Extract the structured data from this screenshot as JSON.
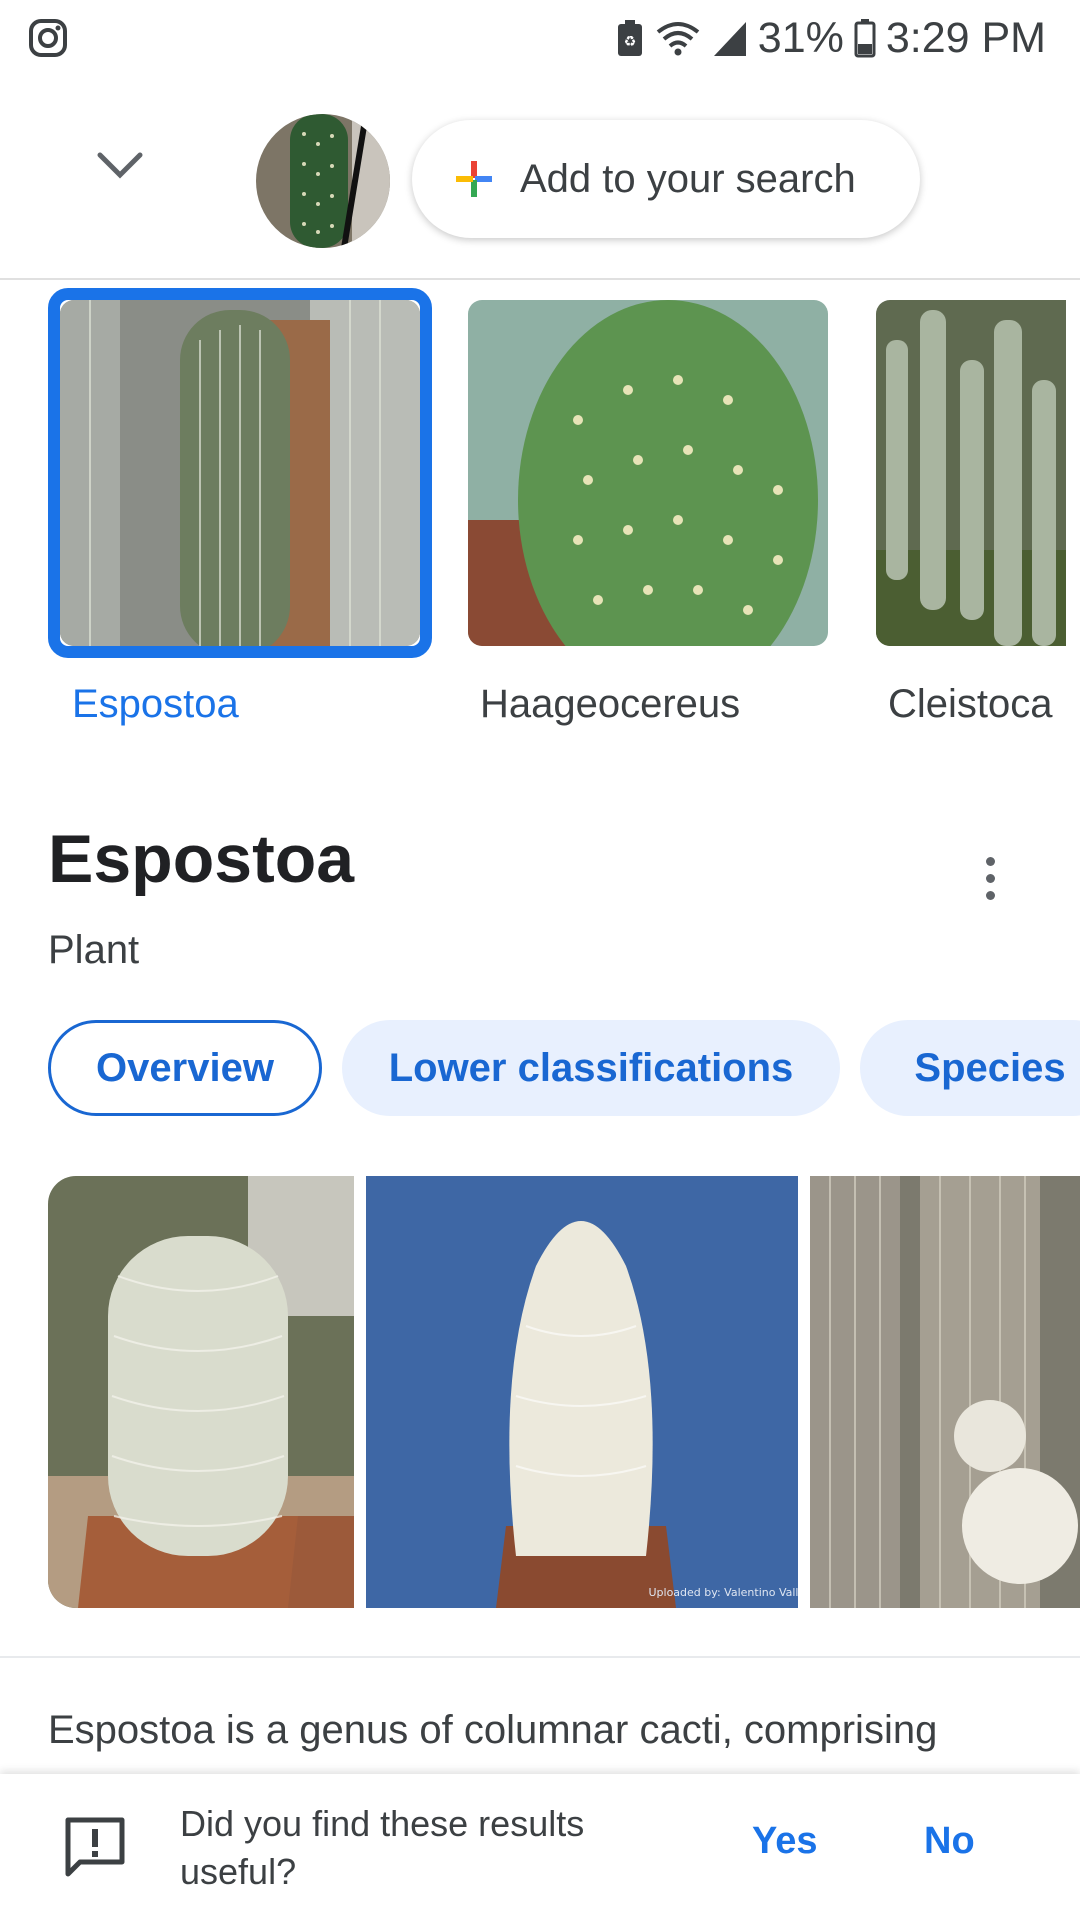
{
  "status_bar": {
    "app_icon": "instagram-icon",
    "battery_percent": "31%",
    "time": "3:29 PM"
  },
  "search": {
    "collapse_icon": "chevron-down-icon",
    "query_image": "cactus-thumbnail",
    "add_button_label": "Add to your search"
  },
  "results": [
    {
      "label": "Espostoa",
      "selected": true
    },
    {
      "label": "Haageocereus",
      "selected": false
    },
    {
      "label": "Cleistoca",
      "selected": false
    }
  ],
  "knowledge_panel": {
    "title": "Espostoa",
    "subtitle": "Plant",
    "tabs": [
      {
        "label": "Overview",
        "active": true
      },
      {
        "label": "Lower classifications",
        "active": false
      },
      {
        "label": "Species",
        "active": false
      }
    ],
    "description": "Espostoa is a genus of columnar cacti, comprising"
  },
  "feedback": {
    "question": "Did you find these results useful?",
    "yes_label": "Yes",
    "no_label": "No"
  },
  "colors": {
    "accent": "#1a73e8",
    "chip_bg": "#e8f0fe"
  }
}
